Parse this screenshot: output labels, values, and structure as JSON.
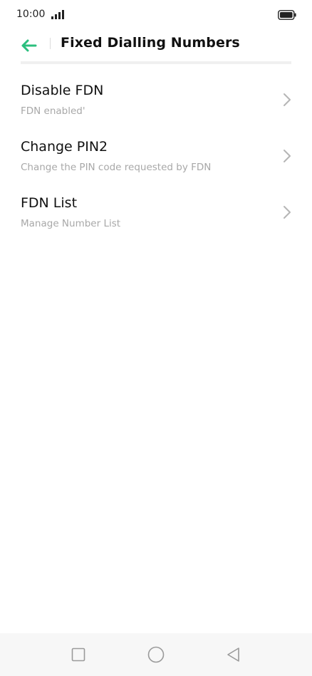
{
  "status_bar": {
    "time": "10:00",
    "signal_icon": "signal-icon",
    "battery_icon": "battery-icon"
  },
  "header": {
    "title": "Fixed Dialling Numbers",
    "back_icon": "arrow-left-icon",
    "accent_color": "#2bbf7e"
  },
  "items": [
    {
      "title": "Disable FDN",
      "subtitle": "FDN enabled'"
    },
    {
      "title": "Change PIN2",
      "subtitle": "Change the PIN code requested by FDN"
    },
    {
      "title": "FDN List",
      "subtitle": "Manage Number List"
    }
  ],
  "nav_bar": {
    "recent_icon": "square-icon",
    "home_icon": "circle-icon",
    "back_icon": "triangle-back-icon"
  }
}
